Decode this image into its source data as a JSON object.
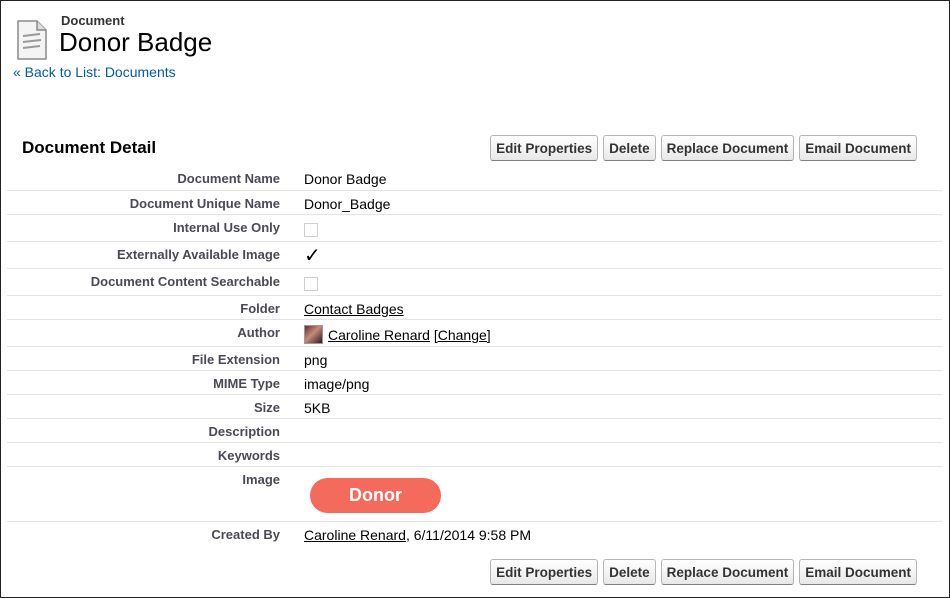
{
  "header": {
    "record_type": "Document",
    "title": "Donor Badge",
    "back_link": "« Back to List: Documents"
  },
  "section": {
    "title": "Document Detail"
  },
  "buttons": {
    "edit": "Edit Properties",
    "delete": "Delete",
    "replace": "Replace Document",
    "email": "Email Document"
  },
  "fields": {
    "document_name": {
      "label": "Document Name",
      "value": "Donor Badge"
    },
    "unique_name": {
      "label": "Document Unique Name",
      "value": "Donor_Badge"
    },
    "internal_use": {
      "label": "Internal Use Only",
      "checked": false
    },
    "externally_available": {
      "label": "Externally Available Image",
      "checked": true,
      "mark": "✓"
    },
    "searchable": {
      "label": "Document Content Searchable",
      "checked": false
    },
    "folder": {
      "label": "Folder",
      "value": "Contact Badges"
    },
    "author": {
      "label": "Author",
      "value": "Caroline Renard",
      "change": "[Change]"
    },
    "file_extension": {
      "label": "File Extension",
      "value": "png"
    },
    "mime_type": {
      "label": "MIME Type",
      "value": "image/png"
    },
    "size": {
      "label": "Size",
      "value": "5KB"
    },
    "description": {
      "label": "Description",
      "value": ""
    },
    "keywords": {
      "label": "Keywords",
      "value": ""
    },
    "image": {
      "label": "Image",
      "badge_text": "Donor",
      "badge_color": "#f46a5c"
    },
    "created_by": {
      "label": "Created By",
      "user": "Caroline Renard",
      "datetime": ", 6/11/2014 9:58 PM"
    }
  },
  "colors": {
    "link": "#015ba7",
    "label": "#4a4a56"
  }
}
